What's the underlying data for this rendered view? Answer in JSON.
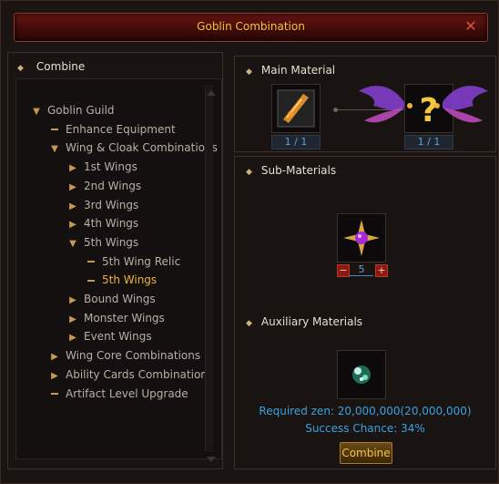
{
  "window": {
    "title": "Goblin Combination"
  },
  "left": {
    "header": "Combine",
    "tree": [
      {
        "label": "Goblin Guild",
        "icon": "arrow-down-icon",
        "level": 0
      },
      {
        "label": "Enhance Equipment",
        "icon": "dash-icon",
        "level": 1
      },
      {
        "label": "Wing & Cloak Combinations",
        "icon": "arrow-down-icon",
        "level": 1
      },
      {
        "label": "1st Wings",
        "icon": "arrow-right-icon",
        "level": 2
      },
      {
        "label": "2nd Wings",
        "icon": "arrow-right-icon",
        "level": 2
      },
      {
        "label": "3rd Wings",
        "icon": "arrow-right-icon",
        "level": 2
      },
      {
        "label": "4th Wings",
        "icon": "arrow-right-icon",
        "level": 2
      },
      {
        "label": "5th Wings",
        "icon": "arrow-down-icon",
        "level": 2
      },
      {
        "label": "5th Wing Relic",
        "icon": "dash-icon",
        "level": 3
      },
      {
        "label": "5th Wings",
        "icon": "dash-icon",
        "level": 3,
        "active": true
      },
      {
        "label": "Bound Wings",
        "icon": "arrow-right-icon",
        "level": 2
      },
      {
        "label": "Monster Wings",
        "icon": "arrow-right-icon",
        "level": 2
      },
      {
        "label": "Event Wings",
        "icon": "arrow-right-icon",
        "level": 2
      },
      {
        "label": "Wing Core Combinations",
        "icon": "arrow-right-icon",
        "level": 1
      },
      {
        "label": "Ability Cards Combinations",
        "icon": "arrow-right-icon",
        "level": 1
      },
      {
        "label": "Artifact Level Upgrade",
        "icon": "dash-icon",
        "level": 1
      }
    ]
  },
  "main_material": {
    "label": "Main Material",
    "input_count": "1 / 1",
    "result_count": "1 / 1",
    "result_placeholder": "?"
  },
  "sub_materials": {
    "label": "Sub-Materials",
    "quantity": "5",
    "minus": "−",
    "plus": "+"
  },
  "auxiliary": {
    "label": "Auxiliary Materials"
  },
  "required_zen": "Required zen: 20,000,000(20,000,000)",
  "success_chance": "Success Chance: 34%",
  "combine_button": "Combine",
  "close_symbol": "✕",
  "colors": {
    "title": "#f1c33a",
    "active": "#f0b13c",
    "info": "#3aa2e0"
  }
}
